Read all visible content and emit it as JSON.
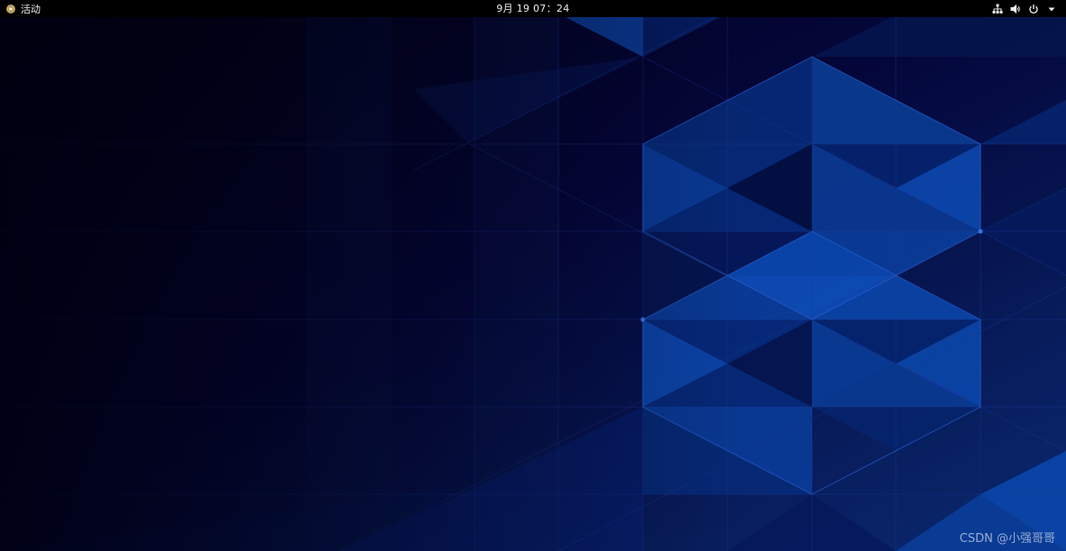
{
  "topbar": {
    "activities_label": "活动",
    "clock": "9月 19  07：24",
    "tray_icons": [
      "network-icon",
      "volume-icon",
      "power-icon",
      "chevron-down-icon"
    ]
  },
  "desktop": {
    "wallpaper": "blue-triangles-wallpaper"
  },
  "watermark": {
    "text": "CSDN @小强哥哥"
  },
  "colors": {
    "topbar_bg": "#000000",
    "topbar_text": "#eeeeec",
    "wallpaper_dark": "#02021a",
    "wallpaper_blue": "#0a3a8a",
    "wallpaper_light_blue": "#1150b5"
  }
}
